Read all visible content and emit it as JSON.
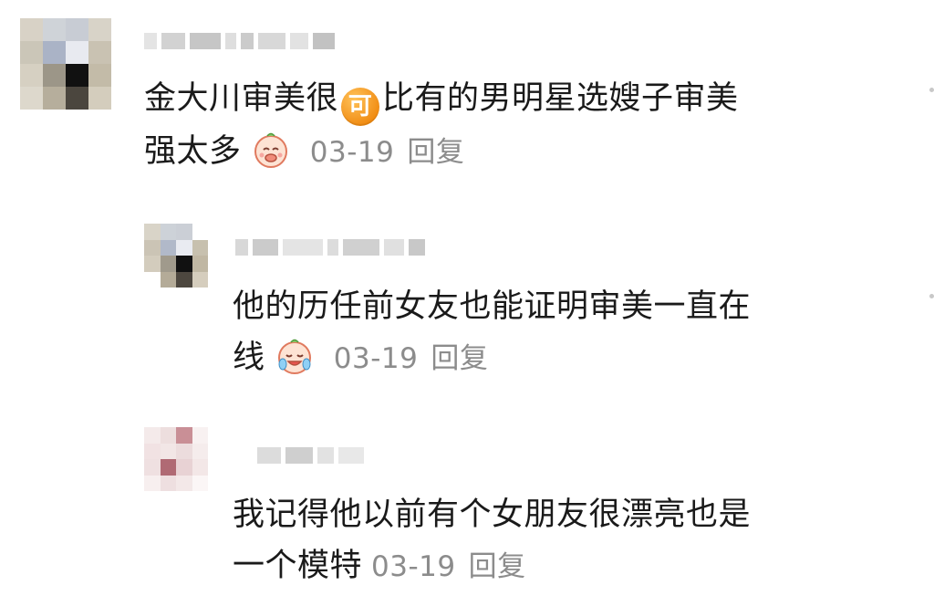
{
  "comments": [
    {
      "text_line1": "金大川审美很",
      "badge": "可",
      "text_line1_rest": "比有的男明星选嫂子审美",
      "text_line2": "强太多",
      "emoji": "laughing-covering-mouth-emoji",
      "date": "03-19",
      "reply": "回复"
    },
    {
      "text_line1": "他的历任前女友也能证明审美一直在",
      "text_line2": "线",
      "emoji": "crying-laughing-emoji",
      "date": "03-19",
      "reply": "回复"
    },
    {
      "text_line1": "我记得他以前有个女朋友很漂亮也是",
      "text_line2": "一个模特",
      "date": "03-19",
      "reply": "回复"
    }
  ],
  "colors": {
    "text": "#1a1a1a",
    "meta": "#8c8c8c",
    "badge": "#f5941c"
  }
}
